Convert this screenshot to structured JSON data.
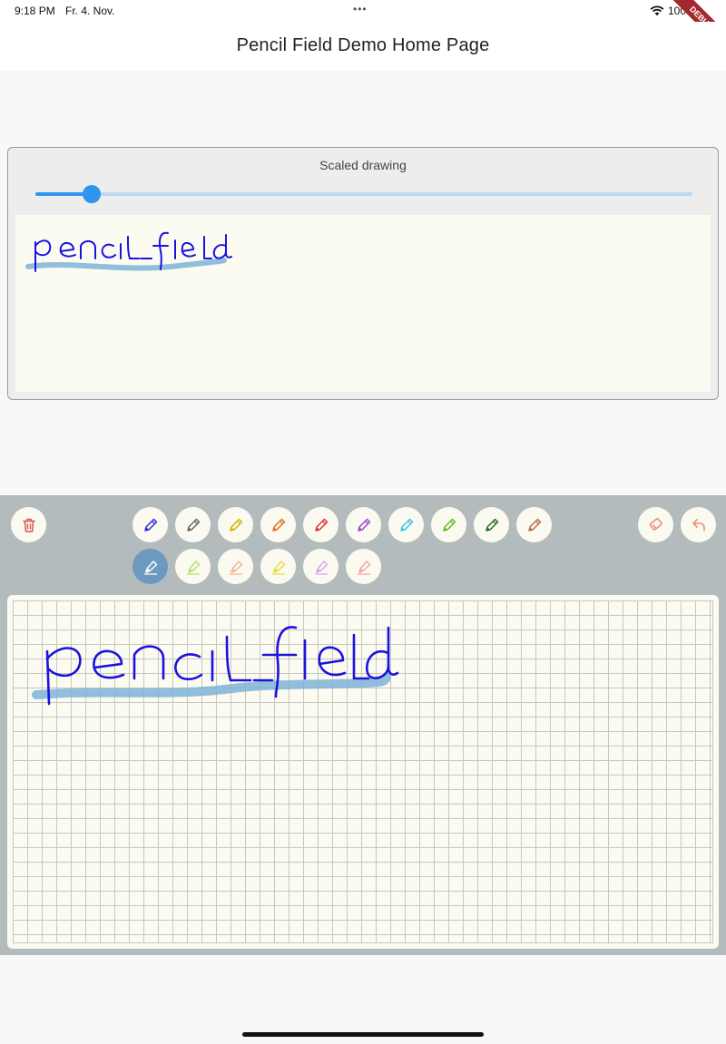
{
  "status_bar": {
    "time": "9:18 PM",
    "date": "Fr. 4. Nov.",
    "dots": "•••",
    "battery": "100 %"
  },
  "debug_banner": "DEBUG",
  "app_bar": {
    "title": "Pencil Field Demo Home Page"
  },
  "scaled_drawing": {
    "label": "Scaled drawing",
    "slider_value": 0.085
  },
  "colors": {
    "accent": "#2e95f1",
    "ink": "#1a12e0",
    "highlighter": "#7fb3d8",
    "panel": "#b4bbbd",
    "paper": "#fcfbf1"
  },
  "toolbar": {
    "left": [
      {
        "name": "trash-icon",
        "color": "#d9534f"
      }
    ],
    "pencils": [
      {
        "name": "pencil-blue-icon",
        "color": "#2e2ee0"
      },
      {
        "name": "pencil-gray-icon",
        "color": "#666666"
      },
      {
        "name": "pencil-yellow-icon",
        "color": "#d6b400"
      },
      {
        "name": "pencil-orange-icon",
        "color": "#e07020"
      },
      {
        "name": "pencil-red-icon",
        "color": "#e03030"
      },
      {
        "name": "pencil-purple-icon",
        "color": "#a040d0"
      },
      {
        "name": "pencil-cyan-icon",
        "color": "#40c0e8"
      },
      {
        "name": "pencil-green-icon",
        "color": "#5cc020"
      },
      {
        "name": "pencil-darkgreen-icon",
        "color": "#2c6a20"
      },
      {
        "name": "pencil-brown-icon",
        "color": "#b07050"
      }
    ],
    "highlighters": [
      {
        "name": "highlighter-blue-icon",
        "color": "#ffffff",
        "selected": true
      },
      {
        "name": "highlighter-lime-icon",
        "color": "#b8e070"
      },
      {
        "name": "highlighter-peach-icon",
        "color": "#f4b890"
      },
      {
        "name": "highlighter-yellow-icon",
        "color": "#e8e040"
      },
      {
        "name": "highlighter-lilac-icon",
        "color": "#dca8ec"
      },
      {
        "name": "highlighter-pink-icon",
        "color": "#f0a8a8"
      }
    ],
    "right": [
      {
        "name": "eraser-icon",
        "color": "#f08080"
      },
      {
        "name": "undo-icon",
        "color": "#f0906a"
      }
    ]
  }
}
